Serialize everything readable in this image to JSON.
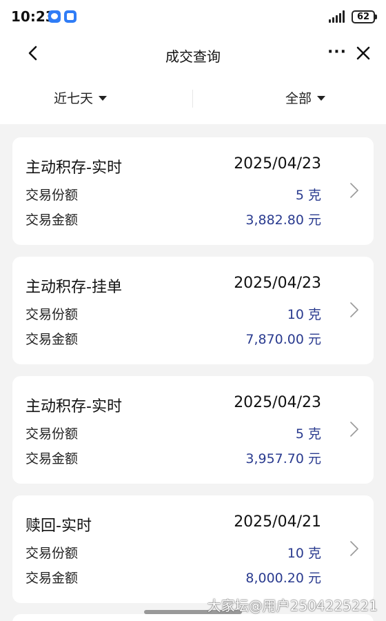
{
  "status": {
    "time": "10:23",
    "battery": "62"
  },
  "nav": {
    "title": "成交查询",
    "more": "···"
  },
  "filters": {
    "period": "近七天",
    "category": "全部"
  },
  "records": [
    {
      "type": "主动积存-实时",
      "date": "2025/04/23",
      "qty_label": "交易份额",
      "qty": "5",
      "qty_unit": "克",
      "amt_label": "交易金额",
      "amount": "3,882.80",
      "amt_unit": "元"
    },
    {
      "type": "主动积存-挂单",
      "date": "2025/04/23",
      "qty_label": "交易份额",
      "qty": "10",
      "qty_unit": "克",
      "amt_label": "交易金额",
      "amount": "7,870.00",
      "amt_unit": "元"
    },
    {
      "type": "主动积存-实时",
      "date": "2025/04/23",
      "qty_label": "交易份额",
      "qty": "5",
      "qty_unit": "克",
      "amt_label": "交易金额",
      "amount": "3,957.70",
      "amt_unit": "元"
    },
    {
      "type": "赎回-实时",
      "date": "2025/04/21",
      "qty_label": "交易份额",
      "qty": "10",
      "qty_unit": "克",
      "amt_label": "交易金额",
      "amount": "8,000.20",
      "amt_unit": "元"
    }
  ],
  "watermark": "大家坛@用户2504225221"
}
